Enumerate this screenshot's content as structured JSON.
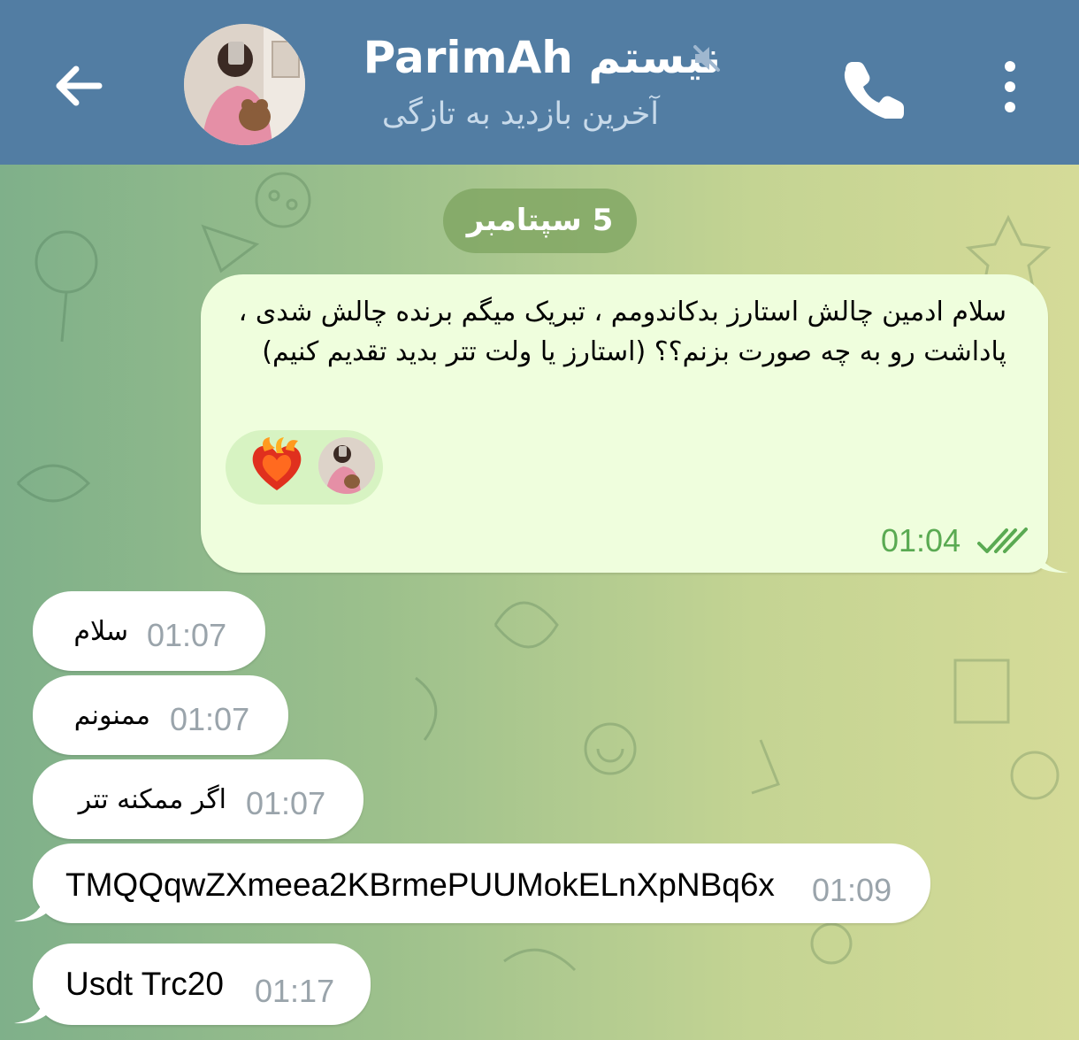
{
  "header": {
    "back_icon": "arrow-left-icon",
    "chat_name": "ParimAh نیستم",
    "muted_icon": "muted-speaker-icon",
    "status": "آخرین بازدید به تازگی",
    "call_icon": "phone-icon",
    "menu_icon": "more-vertical-icon"
  },
  "date_divider": "5 سپتامبر",
  "outgoing": {
    "text": "سلام ادمین چالش استارز بدکاندومم ، تبریک میگم برنده چالش شدی ، پاداشت رو به چه صورت بزنم؟؟ (استارز یا ولت تتر بدید تقدیم کنیم)",
    "reaction_emoji": "fire-heart-emoji",
    "time": "01:04",
    "status_icon": "double-check-icon"
  },
  "incoming": [
    {
      "text": "سلام",
      "time": "01:07"
    },
    {
      "text": "ممنونم",
      "time": "01:07"
    },
    {
      "text": "اگر ممکنه تتر",
      "time": "01:07"
    },
    {
      "text": "TMQQqwZXmeea2KBrmePUUMokELnXpNBq6x",
      "time": "01:09"
    },
    {
      "text": "Usdt Trc20",
      "time": "01:17"
    }
  ],
  "colors": {
    "header": "#527da3",
    "outgoing_bubble": "#effedd",
    "incoming_bubble": "#ffffff",
    "time_read": "#5aaa52",
    "time_incoming": "#9aa4ab",
    "date_pill": "#7ea460"
  }
}
